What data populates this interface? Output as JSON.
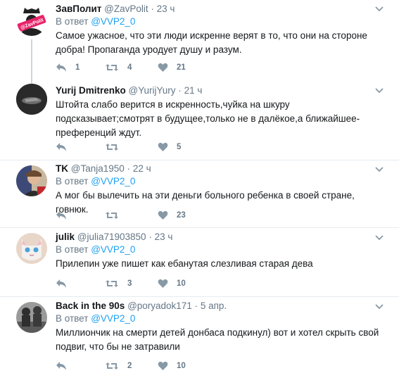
{
  "tweets": [
    {
      "name": "ЗавПолит",
      "handle": "@ZavPolit",
      "time": "23 ч",
      "reply_prefix": "В ответ",
      "reply_to": "@VVP2_0",
      "text": "Самое ужасное, что эти люди искренне верят в то, что они на стороне добра! Пропаганда уродует душу и разум.",
      "replies": "1",
      "retweets": "4",
      "likes": "21",
      "avatar_badge": "@ZavPolit"
    },
    {
      "name": "Yurij Dmitrenko",
      "handle": "@YurijYury",
      "time": "21 ч",
      "text": "Штойта слабо верится в искренность,чуйка на шкуру подсказывает;смотрят в будущее,только не в далёкое,а ближайшее-преференций ждут.",
      "replies": "",
      "retweets": "",
      "likes": "5"
    },
    {
      "name": "TK",
      "handle": "@Tanja1950",
      "time": "22 ч",
      "reply_prefix": "В ответ",
      "reply_to": "@VVP2_0",
      "text": "А мог бы вылечить на эти деньги больного ребенка в своей стране, говнюк.",
      "replies": "",
      "retweets": "",
      "likes": "23"
    },
    {
      "name": "julik",
      "handle": "@julia71903850",
      "time": "23 ч",
      "reply_prefix": "В ответ",
      "reply_to": "@VVP2_0",
      "text": "Прилепин уже пишет как ебанутая слезливая старая дева",
      "replies": "",
      "retweets": "3",
      "likes": "10"
    },
    {
      "name": "Back in the 90s",
      "handle": "@poryadok171",
      "time": "5 апр.",
      "reply_prefix": "В ответ",
      "reply_to": "@VVP2_0",
      "text": "Миллиончик на смерти детей донбаса подкинул) вот и хотел скрыть свой подвиг, что бы не затравили",
      "replies": "",
      "retweets": "2",
      "likes": "10"
    }
  ],
  "separator": "·"
}
